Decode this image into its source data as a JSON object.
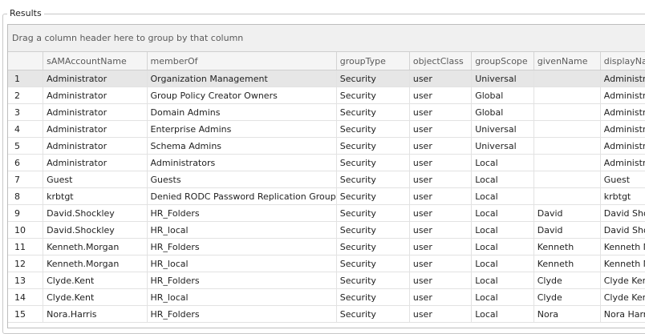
{
  "panel": {
    "legend": "Results"
  },
  "grid": {
    "group_hint": "Drag a column header here to group by that column",
    "columns": [
      "",
      "sAMAccountName",
      "memberOf",
      "groupType",
      "objectClass",
      "groupScope",
      "givenName",
      "displayNa"
    ],
    "rows": [
      [
        "1",
        "Administrator",
        "Organization Management",
        "Security",
        "user",
        "Universal",
        "",
        "Administra"
      ],
      [
        "2",
        "Administrator",
        "Group Policy Creator Owners",
        "Security",
        "user",
        "Global",
        "",
        "Administra"
      ],
      [
        "3",
        "Administrator",
        "Domain Admins",
        "Security",
        "user",
        "Global",
        "",
        "Administra"
      ],
      [
        "4",
        "Administrator",
        "Enterprise Admins",
        "Security",
        "user",
        "Universal",
        "",
        "Administra"
      ],
      [
        "5",
        "Administrator",
        "Schema Admins",
        "Security",
        "user",
        "Universal",
        "",
        "Administra"
      ],
      [
        "6",
        "Administrator",
        "Administrators",
        "Security",
        "user",
        "Local",
        "",
        "Administra"
      ],
      [
        "7",
        "Guest",
        "Guests",
        "Security",
        "user",
        "Local",
        "",
        "Guest"
      ],
      [
        "8",
        "krbtgt",
        "Denied RODC Password Replication Group",
        "Security",
        "user",
        "Local",
        "",
        "krbtgt"
      ],
      [
        "9",
        "David.Shockley",
        "HR_Folders",
        "Security",
        "user",
        "Local",
        "David",
        "David Shoc"
      ],
      [
        "10",
        "David.Shockley",
        "HR_local",
        "Security",
        "user",
        "Local",
        "David",
        "David Shoc"
      ],
      [
        "11",
        "Kenneth.Morgan",
        "HR_Folders",
        "Security",
        "user",
        "Local",
        "Kenneth",
        "Kenneth M"
      ],
      [
        "12",
        "Kenneth.Morgan",
        "HR_local",
        "Security",
        "user",
        "Local",
        "Kenneth",
        "Kenneth M"
      ],
      [
        "13",
        "Clyde.Kent",
        "HR_Folders",
        "Security",
        "user",
        "Local",
        "Clyde",
        "Clyde Ken"
      ],
      [
        "14",
        "Clyde.Kent",
        "HR_local",
        "Security",
        "user",
        "Local",
        "Clyde",
        "Clyde Ken"
      ],
      [
        "15",
        "Nora.Harris",
        "HR_Folders",
        "Security",
        "user",
        "Local",
        "Nora",
        "Nora Harr"
      ]
    ]
  }
}
